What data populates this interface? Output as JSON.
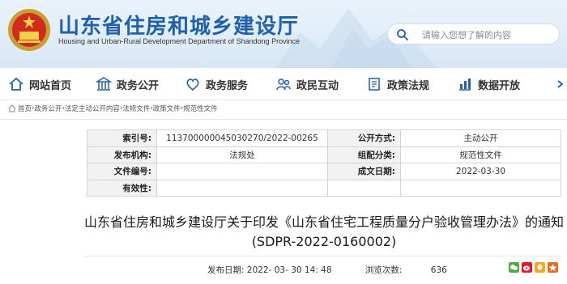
{
  "header": {
    "site_title": "山东省住房和城乡建设厅",
    "site_subtitle": "Housing and Urban-Rural Development Department of Shandong Province",
    "search_placeholder": "请输入您想了解的内容",
    "brand_color": "#1e5fae"
  },
  "nav": {
    "items": [
      {
        "label": "网站首页",
        "icon": "home-icon"
      },
      {
        "label": "政务公开",
        "icon": "government-building-icon"
      },
      {
        "label": "政务服务",
        "icon": "handshake-heart-icon"
      },
      {
        "label": "政民互动",
        "icon": "people-interaction-icon"
      },
      {
        "label": "政策法规",
        "icon": "policy-book-icon"
      },
      {
        "label": "数据开放",
        "icon": "data-chart-icon"
      }
    ]
  },
  "breadcrumb": {
    "items": [
      "首页",
      "政务公开",
      "法定主动公开内容",
      "法规文件",
      "政策文件",
      "规范性文件"
    ],
    "separator": "›"
  },
  "meta": {
    "rows": [
      {
        "k1": "索引号:",
        "v1": "11370000004503027​0/2022-00265",
        "k2": "公开方式:",
        "v2": "主动公开"
      },
      {
        "k1": "发布机构:",
        "v1": "法规处",
        "k2": "组配分类:",
        "v2": "规范性文件"
      },
      {
        "k1": "文件编号:",
        "v1": "",
        "k2": "成文日期:",
        "v2": "2022-03-30"
      },
      {
        "k1": "有效性:",
        "v1": "",
        "k2": "",
        "v2": ""
      }
    ]
  },
  "document": {
    "title": "山东省住房和城乡建设厅关于印发《山东省住宅工程质量分户验收管理办法》的通知(SDPR-2022-0160002)",
    "publish_label": "发布日期:",
    "publish_time": "2022- 03- 30 14: 48",
    "views_label": "浏览次数:",
    "views_count": "636"
  }
}
